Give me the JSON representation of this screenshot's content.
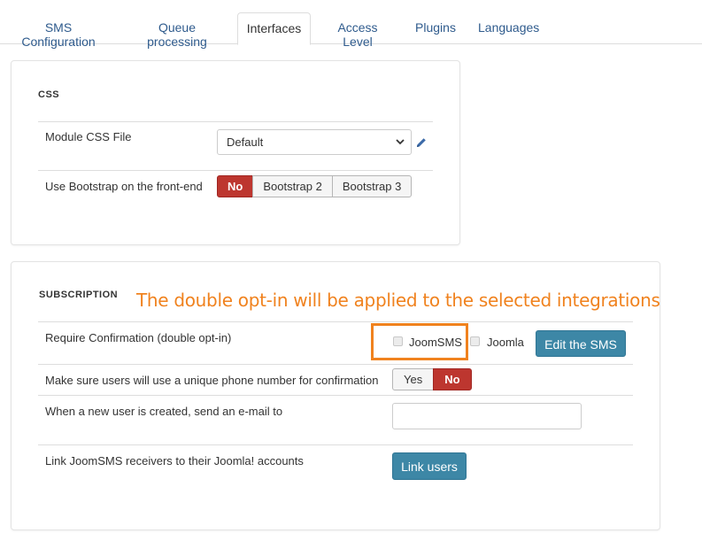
{
  "tabs": [
    {
      "label": "SMS Configuration",
      "active": false
    },
    {
      "label": "Queue processing",
      "active": false
    },
    {
      "label": "Interfaces",
      "active": true
    },
    {
      "label": "Access Level",
      "active": false
    },
    {
      "label": "Plugins",
      "active": false
    },
    {
      "label": "Languages",
      "active": false
    }
  ],
  "css_section": {
    "title": "CSS",
    "module_css_label": "Module CSS File",
    "module_css_value": "Default",
    "bootstrap_label": "Use Bootstrap on the front-end",
    "bootstrap_options": [
      "No",
      "Bootstrap 2",
      "Bootstrap 3"
    ],
    "bootstrap_selected": "No"
  },
  "subscription_section": {
    "title": "SUBSCRIPTION",
    "require_confirmation_label": "Require Confirmation (double opt-in)",
    "confirmation_options": [
      {
        "label": "JoomSMS",
        "checked": false
      },
      {
        "label": "Joomla",
        "checked": false
      }
    ],
    "edit_sms_label": "Edit the SMS",
    "unique_phone_label": "Make sure users will use a unique phone number for confirmation",
    "unique_phone_options": [
      "Yes",
      "No"
    ],
    "unique_phone_selected": "No",
    "new_user_email_label": "When a new user is created, send an e-mail to",
    "new_user_email_value": "",
    "link_users_label": "Link JoomSMS receivers to their Joomla! accounts",
    "link_users_button": "Link users"
  },
  "annotation": {
    "text": "The double opt-in will be applied to the selected integrations",
    "color": "#f0821e"
  },
  "colors": {
    "accent_blue": "#3d87a6",
    "danger_red": "#bd362f",
    "link_blue": "#2f5b8d"
  }
}
